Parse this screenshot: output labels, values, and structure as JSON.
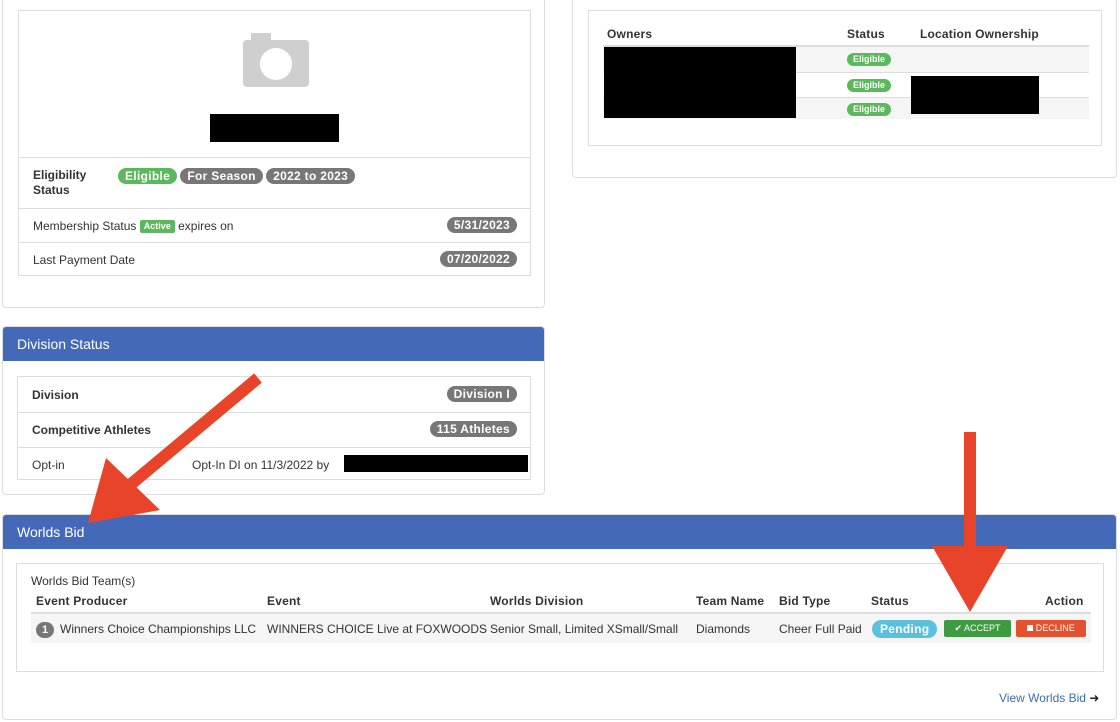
{
  "profile": {
    "eligibility_label": "Eligibility Status",
    "eligibility_badges": [
      "Eligible",
      "For Season",
      "2022 to 2023"
    ],
    "membership_label_pre": "Membership Status",
    "membership_active": "Active",
    "membership_label_post": "expires on",
    "membership_expiry": "5/31/2023",
    "last_payment_label": "Last Payment Date",
    "last_payment_value": "07/20/2022"
  },
  "owners": {
    "headers": [
      "Owners",
      "Status",
      "Location Ownership"
    ],
    "rows": [
      {
        "status": "Eligible"
      },
      {
        "status": "Eligible"
      },
      {
        "status": "Eligible"
      }
    ]
  },
  "division": {
    "title": "Division Status",
    "rows": [
      {
        "label": "Division",
        "value": "Division I"
      },
      {
        "label": "Competitive Athletes",
        "value": "115 Athletes"
      }
    ],
    "optin_label": "Opt-in",
    "optin_text": "Opt-In DI on 11/3/2022 by"
  },
  "worlds": {
    "title": "Worlds Bid",
    "subtitle": "Worlds Bid Team(s)",
    "headers": [
      "Event Producer",
      "Event",
      "Worlds Division",
      "Team Name",
      "Bid Type",
      "Status",
      "Action"
    ],
    "row": {
      "index": "1",
      "producer": "Winners Choice Championships LLC",
      "event": "WINNERS CHOICE Live at FOXWOODS",
      "division": "Senior Small, Limited XSmall/Small",
      "team": "Diamonds",
      "bid_type": "Cheer Full Paid",
      "status": "Pending",
      "accept": "ACCEPT",
      "decline": "DECLINE"
    },
    "view_link": "View Worlds Bid"
  },
  "colors": {
    "header_blue": "#4469b8",
    "eligible_green": "#5cb85c",
    "pending_blue": "#5bc0de",
    "decline_red": "#e4512f",
    "annotation_arrow": "#e8442a"
  }
}
